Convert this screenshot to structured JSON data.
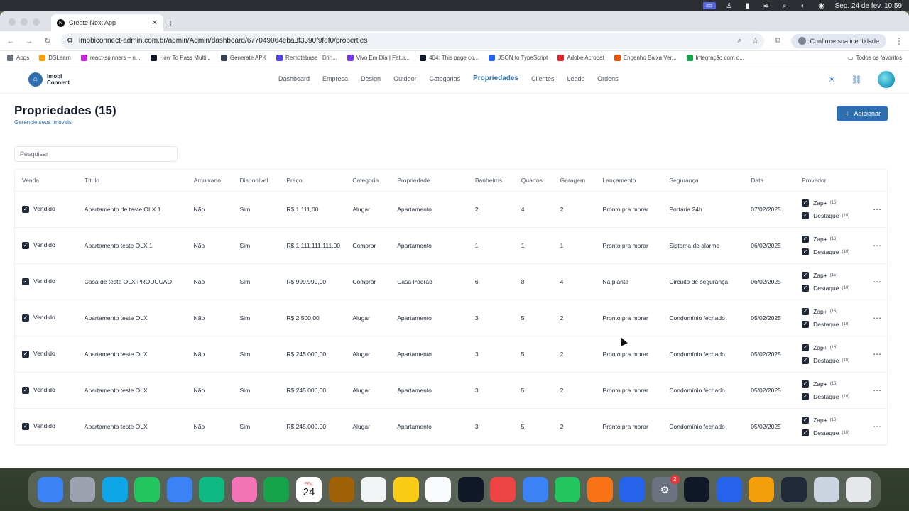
{
  "menubar": {
    "datetime": "Seg. 24 de fev.  10:59"
  },
  "browser": {
    "tab_title": "Create Next App",
    "url": "imobiconnect-admin.com.br/admin/Admin/dashboard/677049064eba3f3390f9fef0/properties",
    "identity_label": "Confirme sua identidade",
    "bookmarks": [
      {
        "label": "Apps",
        "color": "#6b7280"
      },
      {
        "label": "DSLearn",
        "color": "#f59e0b"
      },
      {
        "label": "react-spinners – n...",
        "color": "#c026d3"
      },
      {
        "label": "How To Pass Multi...",
        "color": "#111827"
      },
      {
        "label": "Generate APK",
        "color": "#374151"
      },
      {
        "label": "Remotebase | Brin...",
        "color": "#4f46e5"
      },
      {
        "label": "Vivo Em Dia | Fatur...",
        "color": "#7c3aed"
      },
      {
        "label": "404: This page co...",
        "color": "#111827"
      },
      {
        "label": "JSON to TypeScript",
        "color": "#2563eb"
      },
      {
        "label": "Adobe Acrobat",
        "color": "#dc2626"
      },
      {
        "label": "Engenho Baixa Ver...",
        "color": "#ea580c"
      },
      {
        "label": "Integração com o...",
        "color": "#16a34a"
      }
    ],
    "all_bookmarks": "Todos os favoritos"
  },
  "app": {
    "logo_line1": "Imobi",
    "logo_line2": "Connect",
    "nav": [
      "Dashboard",
      "Empresa",
      "Design",
      "Outdoor",
      "Categorias",
      "Propriedades",
      "Clientes",
      "Leads",
      "Ordens"
    ],
    "active_nav": "Propriedades",
    "page_title": "Propriedades (15)",
    "page_subtitle": "Gerencie seus imóveis",
    "add_label": "Adicionar",
    "search_placeholder": "Pesquisar"
  },
  "table": {
    "headers": [
      "Venda",
      "Título",
      "Arquivado",
      "Disponível",
      "Preço",
      "Categoria",
      "Propriedade",
      "Banheiros",
      "Quartos",
      "Garagem",
      "Lançamento",
      "Segurança",
      "Data",
      "Provedor"
    ],
    "rows": [
      {
        "venda": "Vendido",
        "titulo": "Apartamento de teste OLX 1",
        "arquivado": "Não",
        "disponivel": "Sim",
        "preco": "R$ 1.111,00",
        "categoria": "Alugar",
        "propriedade": "Apartamento",
        "banheiros": "2",
        "quartos": "4",
        "garagem": "2",
        "lancamento": "Pronto pra morar",
        "seguranca": "Portaria 24h",
        "data": "07/02/2025"
      },
      {
        "venda": "Vendido",
        "titulo": "Apartamento teste OLX 1",
        "arquivado": "Não",
        "disponivel": "Sim",
        "preco": "R$ 1.111.111.111,00",
        "categoria": "Comprar",
        "propriedade": "Apartamento",
        "banheiros": "1",
        "quartos": "1",
        "garagem": "1",
        "lancamento": "Pronto pra morar",
        "seguranca": "Sistema de alarme",
        "data": "06/02/2025"
      },
      {
        "venda": "Vendido",
        "titulo": "Casa de teste OLX PRODUCAO",
        "arquivado": "Não",
        "disponivel": "Sim",
        "preco": "R$ 999.999,00",
        "categoria": "Comprar",
        "propriedade": "Casa Padrão",
        "banheiros": "6",
        "quartos": "8",
        "garagem": "4",
        "lancamento": "Na planta",
        "seguranca": "Circuito de segurança",
        "data": "06/02/2025"
      },
      {
        "venda": "Vendido",
        "titulo": "Apartamento teste OLX",
        "arquivado": "Não",
        "disponivel": "Sim",
        "preco": "R$ 2.500,00",
        "categoria": "Alugar",
        "propriedade": "Apartamento",
        "banheiros": "3",
        "quartos": "5",
        "garagem": "2",
        "lancamento": "Pronto pra morar",
        "seguranca": "Condomínio fechado",
        "data": "05/02/2025"
      },
      {
        "venda": "Vendido",
        "titulo": "Apartamento teste OLX",
        "arquivado": "Não",
        "disponivel": "Sim",
        "preco": "R$ 245.000,00",
        "categoria": "Alugar",
        "propriedade": "Apartamento",
        "banheiros": "3",
        "quartos": "5",
        "garagem": "2",
        "lancamento": "Pronto pra morar",
        "seguranca": "Condomínio fechado",
        "data": "05/02/2025"
      },
      {
        "venda": "Vendido",
        "titulo": "Apartamento teste OLX",
        "arquivado": "Não",
        "disponivel": "Sim",
        "preco": "R$ 245.000,00",
        "categoria": "Alugar",
        "propriedade": "Apartamento",
        "banheiros": "3",
        "quartos": "5",
        "garagem": "2",
        "lancamento": "Pronto pra morar",
        "seguranca": "Condomínio fechado",
        "data": "05/02/2025"
      },
      {
        "venda": "Vendido",
        "titulo": "Apartamento teste OLX",
        "arquivado": "Não",
        "disponivel": "Sim",
        "preco": "R$ 245.000,00",
        "categoria": "Alugar",
        "propriedade": "Apartamento",
        "banheiros": "3",
        "quartos": "5",
        "garagem": "2",
        "lancamento": "Pronto pra morar",
        "seguranca": "Condomínio fechado",
        "data": "05/02/2025"
      }
    ],
    "provider_zap": "Zap+",
    "provider_zap_count": "(15)",
    "provider_destaque": "Destaque",
    "provider_destaque_count": "(10)"
  },
  "dock": {
    "calendar_month": "FEV.",
    "calendar_day": "24",
    "settings_badge": "2",
    "apps": [
      {
        "icon": "finder-icon",
        "color": "#3b82f6"
      },
      {
        "icon": "launchpad-icon",
        "color": "#9ca3af"
      },
      {
        "icon": "safari-icon",
        "color": "#0ea5e9"
      },
      {
        "icon": "messages-icon",
        "color": "#22c55e"
      },
      {
        "icon": "mail-icon",
        "color": "#3b82f6"
      },
      {
        "icon": "maps-icon",
        "color": "#10b981"
      },
      {
        "icon": "photos-icon",
        "color": "#f472b6"
      },
      {
        "icon": "facetime-icon",
        "color": "#16a34a"
      },
      {
        "icon": "calendar-icon",
        "color": "#ffffff"
      },
      {
        "icon": "contacts-icon",
        "color": "#a16207"
      },
      {
        "icon": "reminders-icon",
        "color": "#f3f4f6"
      },
      {
        "icon": "notes-icon",
        "color": "#facc15"
      },
      {
        "icon": "freeform-icon",
        "color": "#f9fafb"
      },
      {
        "icon": "tv-icon",
        "color": "#111827"
      },
      {
        "icon": "music-icon",
        "color": "#ef4444"
      },
      {
        "icon": "keynote-icon",
        "color": "#3b82f6"
      },
      {
        "icon": "numbers-icon",
        "color": "#22c55e"
      },
      {
        "icon": "pages-icon",
        "color": "#f97316"
      },
      {
        "icon": "app-store-icon",
        "color": "#2563eb"
      },
      {
        "icon": "system-settings-icon",
        "color": "#6b7280"
      },
      {
        "icon": "terminal-icon",
        "color": "#111827"
      },
      {
        "icon": "vscode-icon",
        "color": "#2563eb"
      },
      {
        "icon": "chrome-icon",
        "color": "#f59e0b"
      },
      {
        "icon": "activity-monitor-icon",
        "color": "#1f2937"
      },
      {
        "icon": "preview-icon",
        "color": "#cbd5e1"
      },
      {
        "icon": "trash-icon",
        "color": "#e5e7eb"
      }
    ]
  }
}
